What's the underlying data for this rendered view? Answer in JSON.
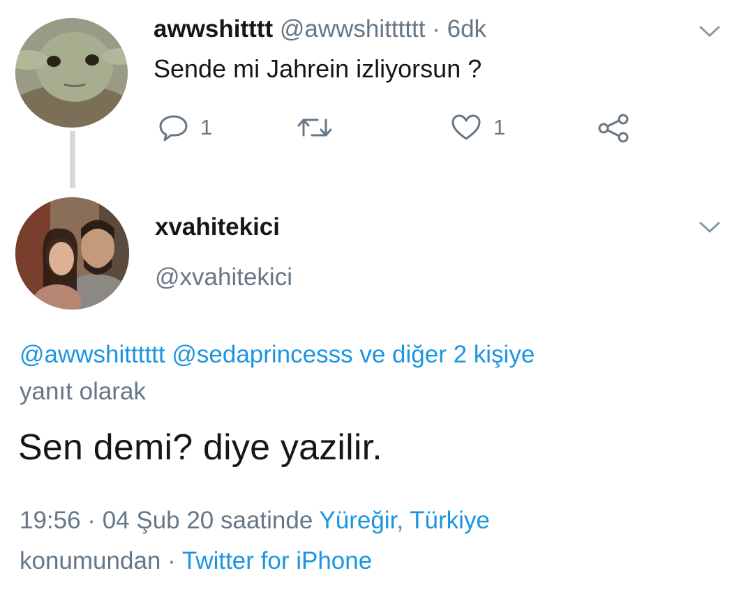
{
  "parent_tweet": {
    "display_name": "awwshitttt",
    "handle": "@awwshitttttt",
    "separator": "·",
    "time": "6dk",
    "text": "Sende mi Jahrein izliyorsun ?",
    "reply_count": "1",
    "like_count": "1"
  },
  "reply_tweet": {
    "display_name": "xvahitekici",
    "handle": "@xvahitekici",
    "replying_to_mentions": "@awwshitttttt @sedaprincesss ve diğer 2 kişiye",
    "replying_to_suffix": "yanıt olarak",
    "text": "Sen demi? diye yazilir.",
    "timestamp": "19:56 · 04 Şub 20 saatinde",
    "location": "Yüreğir, Türkiye",
    "location_suffix": "konumundan ·",
    "source": "Twitter for iPhone"
  },
  "icons": {
    "reply": "reply-icon",
    "retweet": "retweet-icon",
    "like": "heart-icon",
    "share": "share-icon",
    "more": "chevron-down-icon"
  },
  "colors": {
    "link": "#1b95e0",
    "muted": "#657786",
    "text": "#14171a",
    "thread_line": "#d6dadd"
  }
}
